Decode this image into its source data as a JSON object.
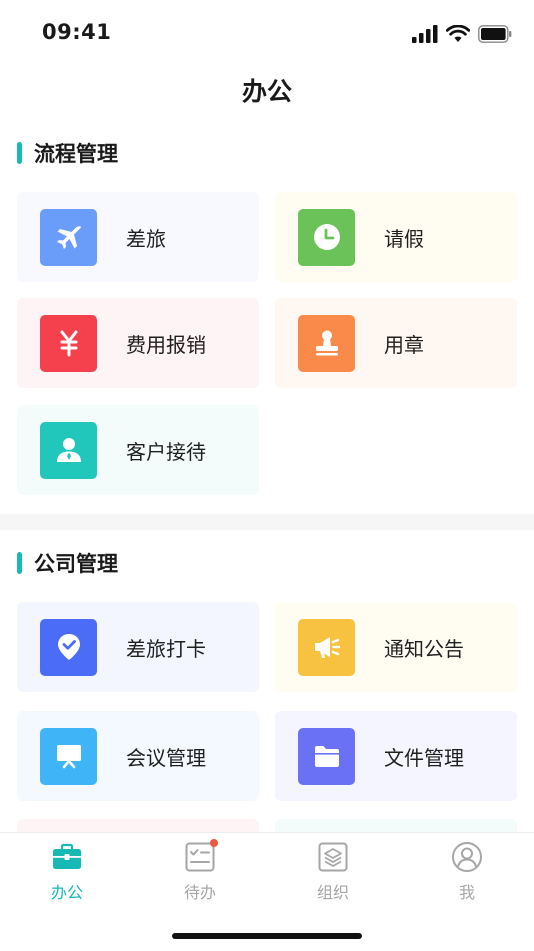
{
  "status_bar": {
    "time": "09:41"
  },
  "header": {
    "title": "办公"
  },
  "sections": [
    {
      "title": "流程管理",
      "items": [
        {
          "label": "差旅",
          "icon": "airplane-icon",
          "icon_color": "#6a9cf9",
          "card_bg": "#f7f9ff"
        },
        {
          "label": "请假",
          "icon": "clock-icon",
          "icon_color": "#6ac259",
          "card_bg": "#fffcf2"
        },
        {
          "label": "费用报销",
          "icon": "yen-icon",
          "icon_color": "#f5404e",
          "card_bg": "#fff4f5"
        },
        {
          "label": "用章",
          "icon": "stamp-icon",
          "icon_color": "#fa8a4a",
          "card_bg": "#fff7f2"
        },
        {
          "label": "客户接待",
          "icon": "reception-icon",
          "icon_color": "#22c7bb",
          "card_bg": "#f3fcfb"
        }
      ]
    },
    {
      "title": "公司管理",
      "items": [
        {
          "label": "差旅打卡",
          "icon": "location-check-icon",
          "icon_color": "#4a6cf7",
          "card_bg": "#f3f6ff"
        },
        {
          "label": "通知公告",
          "icon": "megaphone-icon",
          "icon_color": "#f7c240",
          "card_bg": "#fffcf2"
        },
        {
          "label": "会议管理",
          "icon": "presentation-icon",
          "icon_color": "#3fb4f7",
          "card_bg": "#f4f9ff"
        },
        {
          "label": "文件管理",
          "icon": "folder-icon",
          "icon_color": "#6b71f5",
          "card_bg": "#f5f5ff"
        }
      ]
    }
  ],
  "tabbar": {
    "accent_color": "#17b9b4",
    "tabs": [
      {
        "label": "办公",
        "icon": "briefcase-icon",
        "active": true
      },
      {
        "label": "待办",
        "icon": "checklist-icon",
        "active": false,
        "badge": true
      },
      {
        "label": "组织",
        "icon": "layers-icon",
        "active": false
      },
      {
        "label": "我",
        "icon": "profile-icon",
        "active": false
      }
    ]
  }
}
